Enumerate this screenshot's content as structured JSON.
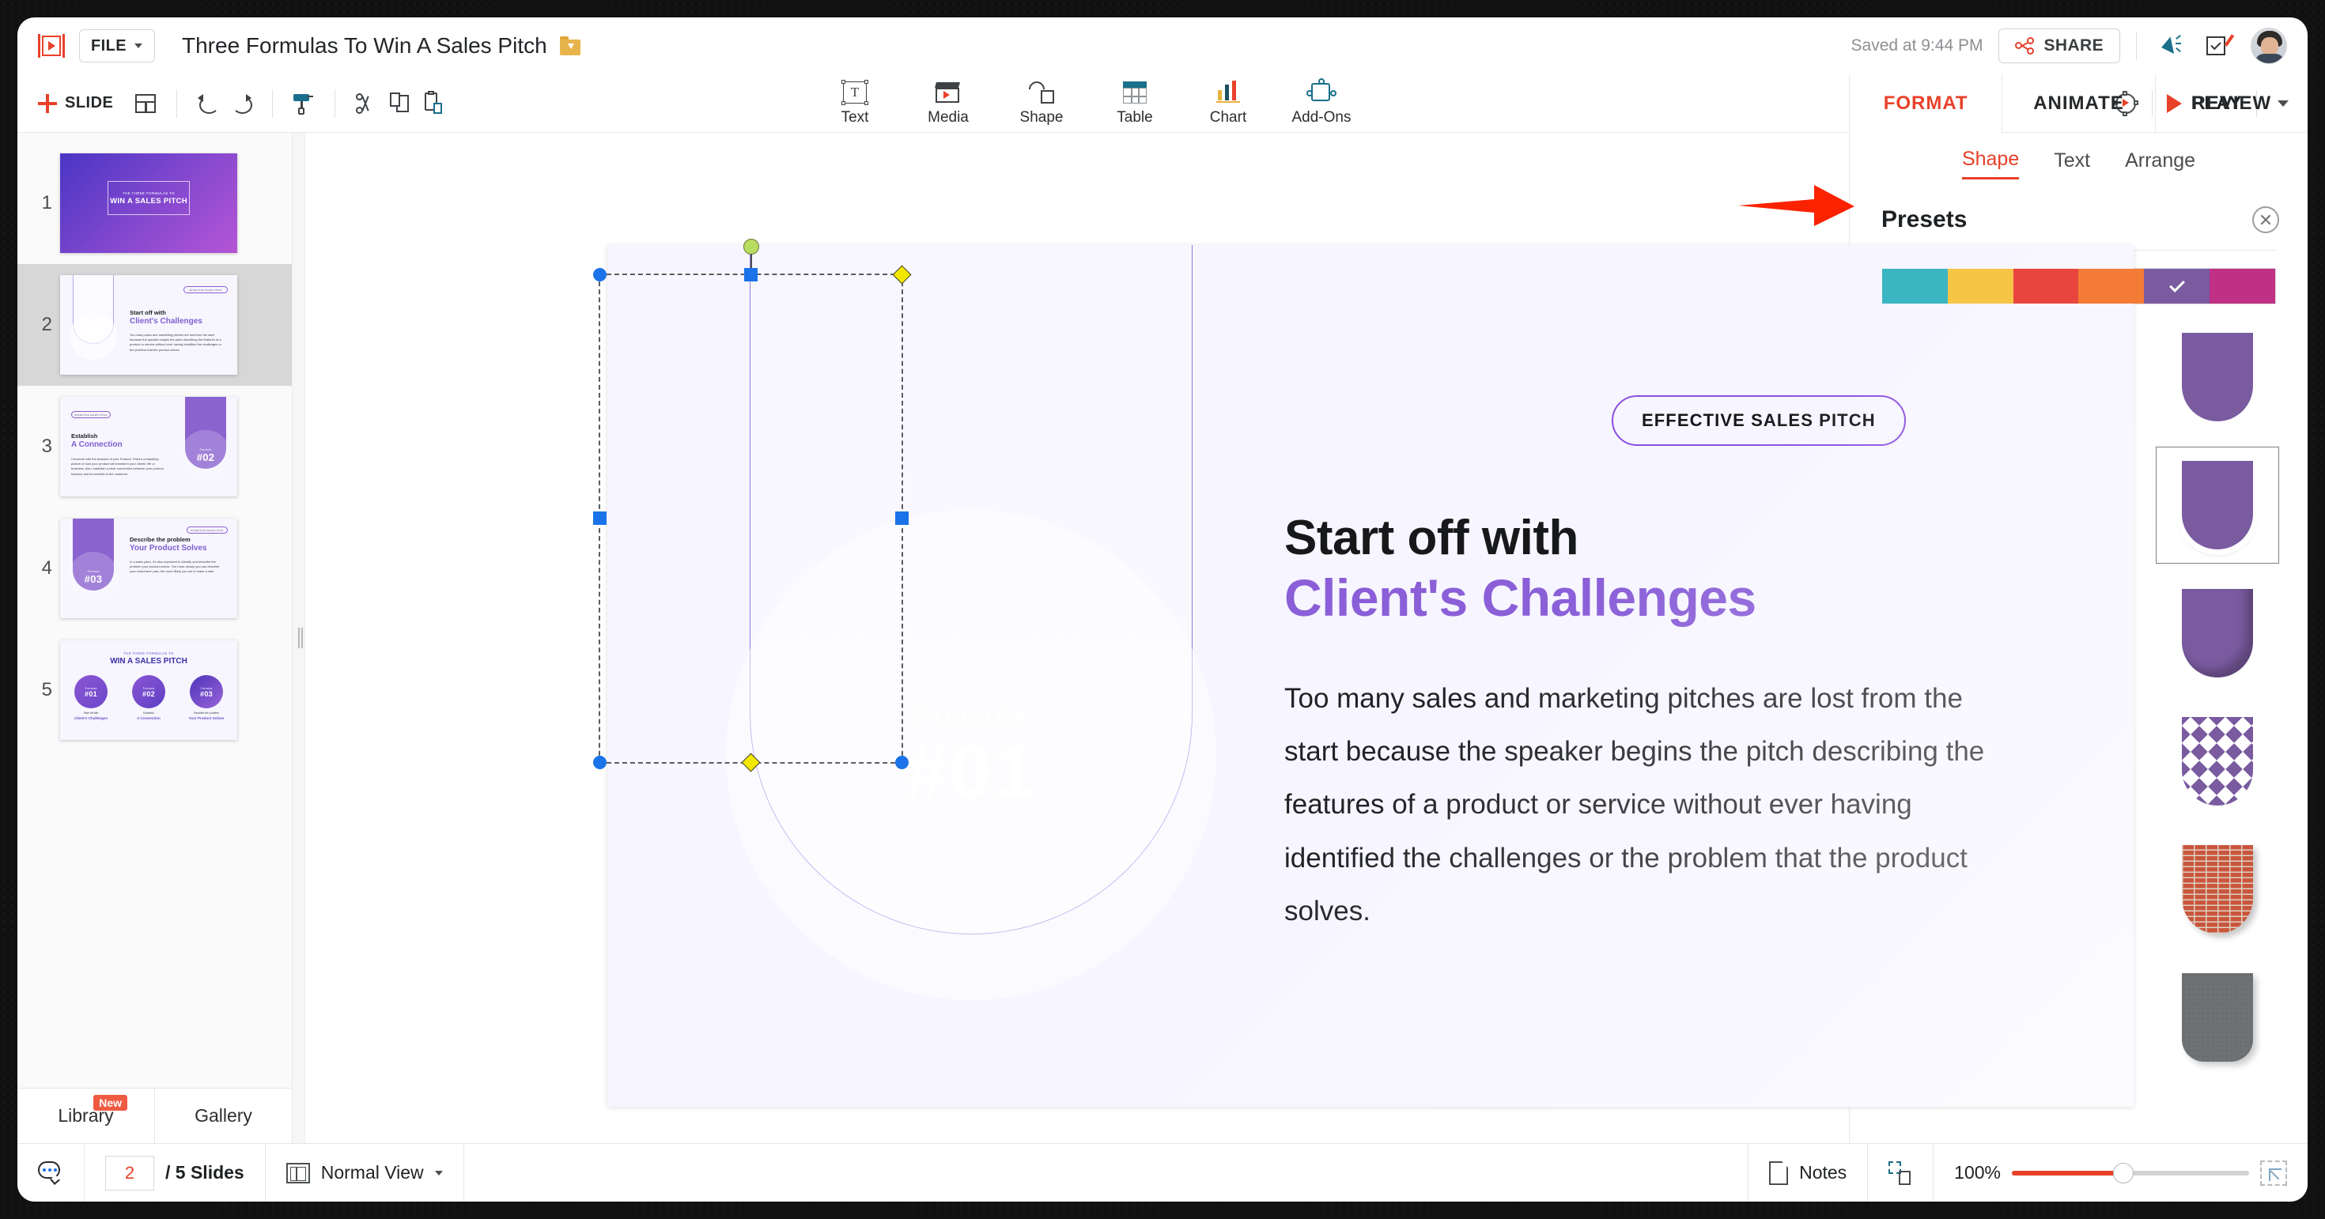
{
  "topbar": {
    "logo_icon": "zoho-show-logo-icon",
    "file_menu": "FILE",
    "document_title": "Three Formulas To Win A Sales Pitch",
    "folder_icon": "folder-move-icon",
    "saved_status": "Saved at 9:44 PM",
    "share_label": "SHARE",
    "share_icon": "share-nodes-icon",
    "announce_icon": "megaphone-icon",
    "feedback_icon": "feedback-pencil-icon",
    "avatar_icon": "user-avatar"
  },
  "ribbon": {
    "add_slide": "SLIDE",
    "layout_icon": "slide-layout-icon",
    "undo_icon": "undo-icon",
    "redo_icon": "redo-icon",
    "format_painter_icon": "format-painter-icon",
    "cut_icon": "scissors-icon",
    "copy_icon": "copy-icon",
    "paste_icon": "paste-icon",
    "insert": [
      {
        "label": "Text",
        "icon": "text-box-icon"
      },
      {
        "label": "Media",
        "icon": "media-clapperboard-icon"
      },
      {
        "label": "Shape",
        "icon": "shape-icon"
      },
      {
        "label": "Table",
        "icon": "table-icon"
      },
      {
        "label": "Chart",
        "icon": "bar-chart-icon"
      },
      {
        "label": "Add-Ons",
        "icon": "puzzle-piece-icon"
      }
    ],
    "settings_icon": "gear-play-icon",
    "play_label": "PLAY",
    "play_icon": "play-triangle-icon",
    "play_dropdown_icon": "chevron-down-icon"
  },
  "panel_tabs": [
    {
      "label": "FORMAT",
      "active": true
    },
    {
      "label": "ANIMATE",
      "active": false
    },
    {
      "label": "REVIEW",
      "active": false
    }
  ],
  "slides_pane": {
    "slides": [
      {
        "num": "1",
        "selected": false,
        "kind": "cover",
        "eyebrow": "THE THREE FORMULAS TO",
        "title": "WIN A SALES PITCH"
      },
      {
        "num": "2",
        "selected": true,
        "kind": "content-left",
        "pill": "EFFECTIVE SALES PITCH",
        "h1": "Start off with",
        "h2": "Client's Challenges",
        "formula_label": "Formula",
        "formula_num": "#01",
        "body": "Too many sales and marketing pitches are lost from the start because the speaker begins the pitch describing the features of a product or service without ever having identified the challenges or the problem that the product solves."
      },
      {
        "num": "3",
        "selected": false,
        "kind": "content-right",
        "pill": "EFFECTIVE SALES PITCH",
        "h1": "Establish",
        "h2": "A Connection",
        "formula_label": "Formula",
        "formula_num": "#02",
        "body": "Conclude with the features of your Product. Paint a compelling picture of how your product will transform your clients' life or business. Also, establish a clear connection between your product features and its benefits to the customer."
      },
      {
        "num": "4",
        "selected": false,
        "kind": "content-left-filled",
        "pill": "EFFECTIVE SALES PITCH",
        "h1": "Describe the problem",
        "h2": "Your Product Solves",
        "formula_label": "Formula",
        "formula_num": "#03",
        "body": "In a sales pitch, it's also important to identify and describe the problem your product solves. The more clearly you can describe your customers' pain, the more likely you are to make a sale."
      },
      {
        "num": "5",
        "selected": false,
        "kind": "summary",
        "eyebrow": "THE THREE FORMULAS TO",
        "title": "WIN A SALES PITCH",
        "items": [
          {
            "formula_label": "Formula",
            "formula_num": "#01",
            "cap1": "Start off with",
            "cap2": "Client's Challenges"
          },
          {
            "formula_label": "Formula",
            "formula_num": "#02",
            "cap1": "Establish",
            "cap2": "A Connection"
          },
          {
            "formula_label": "Formula",
            "formula_num": "#03",
            "cap1": "Describe the problem",
            "cap2": "Your Product Solves"
          }
        ]
      }
    ],
    "library_label": "Library",
    "library_badge": "New",
    "gallery_label": "Gallery"
  },
  "canvas": {
    "pill": "EFFECTIVE SALES PITCH",
    "heading_line1": "Start off with",
    "heading_line2": "Client's Challenges",
    "body": "Too many sales and marketing pitches are lost from the start because the speaker begins the pitch describing the features of a product or service without ever having identified the challenges or the problem that the product solves.",
    "shape_formula_label": "Formula",
    "shape_formula_num": "#01",
    "selection": {
      "rotate_handle_icon": "rotate-handle",
      "corner_handle_icon": "resize-handle-corner",
      "edge_handle_icon": "resize-handle-edge",
      "adjust_handle_icon": "shape-adjust-handle"
    },
    "annotation_arrow_icon": "red-arrow-pointing-right"
  },
  "format_panel": {
    "sub_tabs": [
      {
        "label": "Shape",
        "active": true
      },
      {
        "label": "Text",
        "active": false
      },
      {
        "label": "Arrange",
        "active": false
      }
    ],
    "section_title": "Presets",
    "close_icon": "close-circle-icon",
    "swatches": [
      {
        "name": "teal",
        "hex": "#3ab5c2",
        "selected": false
      },
      {
        "name": "yellow",
        "hex": "#f7c546",
        "selected": false
      },
      {
        "name": "red",
        "hex": "#e8453f",
        "selected": false
      },
      {
        "name": "orange",
        "hex": "#f47b36",
        "selected": false
      },
      {
        "name": "purple",
        "hex": "#7a5ba0",
        "selected": true
      },
      {
        "name": "magenta",
        "hex": "#c03084",
        "selected": false
      }
    ],
    "presets": [
      {
        "name": "outline",
        "selected": false
      },
      {
        "name": "dashed-outline",
        "selected": false
      },
      {
        "name": "solid-fill",
        "selected": false
      },
      {
        "name": "gradient-light",
        "selected": false
      },
      {
        "name": "gradient-fade",
        "selected": false
      },
      {
        "name": "white-border",
        "selected": true
      },
      {
        "name": "drop-shadow",
        "selected": false
      },
      {
        "name": "flat",
        "selected": false
      },
      {
        "name": "inner-shadow",
        "selected": false
      },
      {
        "name": "diagonal-stripes",
        "selected": false
      },
      {
        "name": "polka-dots",
        "selected": false
      },
      {
        "name": "chevron",
        "selected": false
      },
      {
        "name": "dark-wood",
        "selected": false
      },
      {
        "name": "light-wood",
        "selected": false
      },
      {
        "name": "brick",
        "selected": false
      },
      {
        "name": "dark-texture",
        "selected": false
      },
      {
        "name": "white-texture",
        "selected": false
      },
      {
        "name": "grey-texture",
        "selected": false
      }
    ]
  },
  "statusbar": {
    "comment_icon": "comment-icon",
    "current_slide": "2",
    "slide_count": "/ 5 Slides",
    "view_icon": "normal-view-icon",
    "view_label": "Normal View",
    "view_dropdown_icon": "chevron-down-icon",
    "notes_icon": "notes-page-icon",
    "notes_label": "Notes",
    "fit_icon": "snap-to-grid-icon",
    "zoom_level": "100%",
    "zoom_slider_icon": "zoom-slider",
    "fit_screen_icon": "fit-to-screen-icon"
  }
}
